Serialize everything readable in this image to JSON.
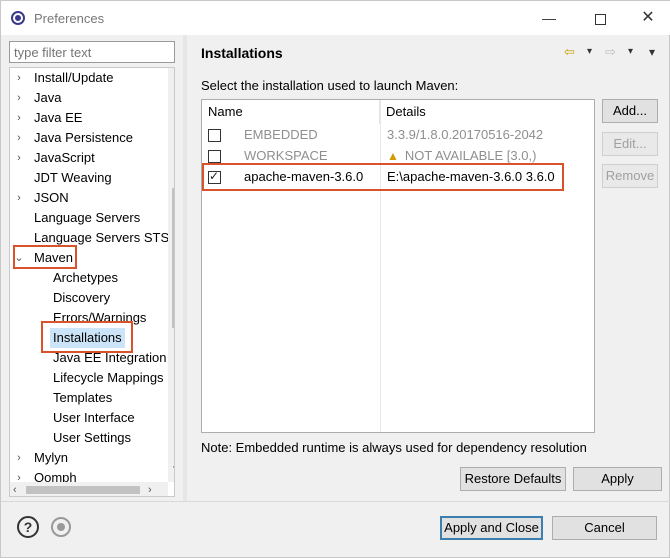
{
  "window": {
    "title": "Preferences",
    "min_glyph": "—",
    "close_glyph": "✕"
  },
  "filter": {
    "placeholder": "type filter text"
  },
  "tree": {
    "items": [
      {
        "label": "Install/Update",
        "twisty": "›"
      },
      {
        "label": "Java",
        "twisty": "›"
      },
      {
        "label": "Java EE",
        "twisty": "›"
      },
      {
        "label": "Java Persistence",
        "twisty": "›"
      },
      {
        "label": "JavaScript",
        "twisty": "›"
      },
      {
        "label": "JDT Weaving",
        "twisty": ""
      },
      {
        "label": "JSON",
        "twisty": "›"
      },
      {
        "label": "Language Servers",
        "twisty": ""
      },
      {
        "label": "Language Servers STS",
        "twisty": ""
      },
      {
        "label": "Maven",
        "twisty": "⌄"
      },
      {
        "label": "Archetypes",
        "twisty": ""
      },
      {
        "label": "Discovery",
        "twisty": ""
      },
      {
        "label": "Errors/Warnings",
        "twisty": ""
      },
      {
        "label": "Installations",
        "twisty": ""
      },
      {
        "label": "Java EE Integration",
        "twisty": ""
      },
      {
        "label": "Lifecycle Mappings",
        "twisty": ""
      },
      {
        "label": "Templates",
        "twisty": ""
      },
      {
        "label": "User Interface",
        "twisty": ""
      },
      {
        "label": "User Settings",
        "twisty": ""
      },
      {
        "label": "Mylyn",
        "twisty": "›"
      },
      {
        "label": "Oomph",
        "twisty": "›"
      }
    ],
    "selected": "Installations"
  },
  "page": {
    "title": "Installations",
    "description": "Select the installation used to launch Maven:",
    "note": "Note: Embedded runtime is always used for dependency resolution"
  },
  "table": {
    "headers": {
      "name": "Name",
      "details": "Details"
    },
    "rows": [
      {
        "name": "EMBEDDED",
        "details": "3.3.9/1.8.0.20170516-2042",
        "checked": false,
        "enabled": false
      },
      {
        "name": "WORKSPACE",
        "details": "NOT AVAILABLE [3.0,)",
        "checked": false,
        "enabled": false,
        "warning": true
      },
      {
        "name": "apache-maven-3.6.0",
        "details": "E:\\apache-maven-3.6.0 3.6.0",
        "checked": true,
        "enabled": true
      }
    ]
  },
  "buttons": {
    "add": "Add...",
    "edit": "Edit...",
    "remove": "Remove",
    "restore_defaults": "Restore Defaults",
    "apply": "Apply",
    "apply_and_close": "Apply and Close",
    "cancel": "Cancel"
  },
  "icons": {
    "back": "⇦",
    "forward": "⇨",
    "dropdown": "▾",
    "more": "▾",
    "help": "?",
    "warning": "▲"
  },
  "colors": {
    "highlight": "#d9532a",
    "selection": "#cce4f7",
    "primary_border": "#3c7fb1"
  }
}
